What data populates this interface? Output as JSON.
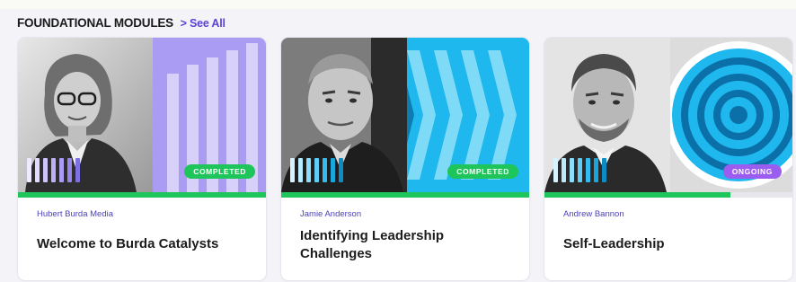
{
  "section": {
    "title": "FOUNDATIONAL MODULES",
    "see_all_chevron": ">",
    "see_all_label": "See All"
  },
  "colors": {
    "accent": "#5b43d6",
    "completed": "#1ec55a",
    "ongoing": "#9b5cf0",
    "lavender": "#a99cf2",
    "cyan": "#1fb8ee"
  },
  "cards": [
    {
      "author": "Hubert Burda Media",
      "title": "Welcome to Burda Catalysts",
      "status": "COMPLETED",
      "progress": 1.0
    },
    {
      "author": "Jamie Anderson",
      "title": "Identifying Leadership Challenges",
      "status": "COMPLETED",
      "progress": 1.0
    },
    {
      "author": "Andrew Bannon",
      "title": "Self-Leadership",
      "status": "ONGOING",
      "progress": 0.75
    }
  ]
}
